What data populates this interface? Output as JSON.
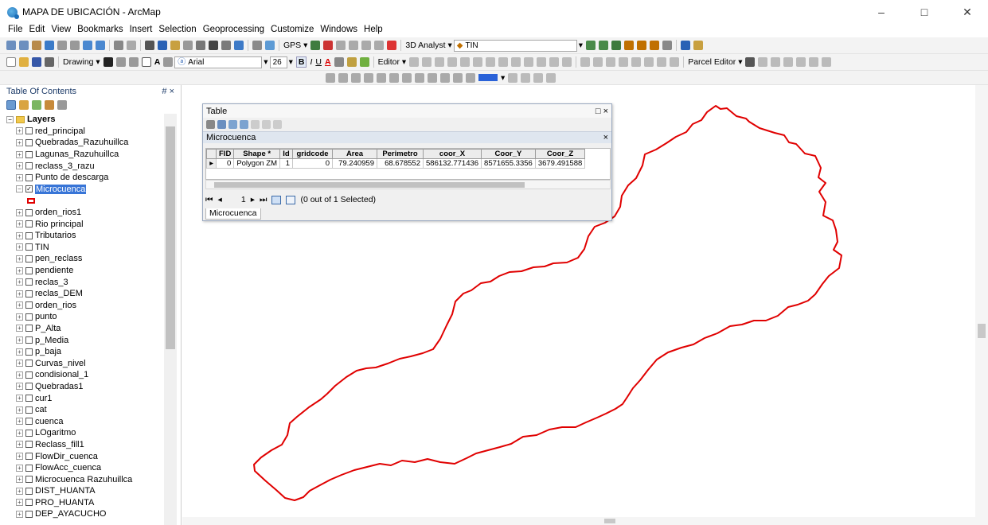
{
  "window": {
    "title": "MAPA DE UBICACIÓN - ArcMap",
    "minimize": "–",
    "maximize": "□",
    "close": "✕"
  },
  "menu": [
    "File",
    "Edit",
    "View",
    "Bookmarks",
    "Insert",
    "Selection",
    "Geoprocessing",
    "Customize",
    "Windows",
    "Help"
  ],
  "toolbar1": {
    "gps": "GPS ▾",
    "analyst": "3D Analyst ▾",
    "tin": "TIN"
  },
  "toolbar2": {
    "drawing": "Drawing ▾",
    "font": "Arial",
    "size": "26",
    "bold": "B",
    "italic": "I",
    "underline": "U",
    "editor": "Editor ▾",
    "parcel": "Parcel Editor ▾"
  },
  "toc": {
    "title": "Table Of Contents",
    "pin": "# ×",
    "root": "Layers",
    "layers": [
      {
        "name": "red_principal",
        "checked": false
      },
      {
        "name": "Quebradas_Razuhuillca",
        "checked": false
      },
      {
        "name": "Lagunas_Razuhuillca",
        "checked": false
      },
      {
        "name": "reclass_3_razu",
        "checked": false
      },
      {
        "name": "Punto de descarga",
        "checked": false
      },
      {
        "name": "Microcuenca",
        "checked": true,
        "selected": true
      },
      {
        "name": "orden_rios1",
        "checked": false
      },
      {
        "name": "Rio principal",
        "checked": false
      },
      {
        "name": "Tributarios",
        "checked": false
      },
      {
        "name": "TIN",
        "checked": false
      },
      {
        "name": "pen_reclass",
        "checked": false
      },
      {
        "name": "pendiente",
        "checked": false
      },
      {
        "name": "reclas_3",
        "checked": false
      },
      {
        "name": "reclas_DEM",
        "checked": false
      },
      {
        "name": "orden_rios",
        "checked": false
      },
      {
        "name": "punto",
        "checked": false
      },
      {
        "name": "P_Alta",
        "checked": false
      },
      {
        "name": "p_Media",
        "checked": false
      },
      {
        "name": "p_baja",
        "checked": false
      },
      {
        "name": "Curvas_nivel",
        "checked": false
      },
      {
        "name": "condisional_1",
        "checked": false
      },
      {
        "name": "Quebradas1",
        "checked": false
      },
      {
        "name": "cur1",
        "checked": false
      },
      {
        "name": "cat",
        "checked": false
      },
      {
        "name": "cuenca",
        "checked": false
      },
      {
        "name": "LOgaritmo",
        "checked": false
      },
      {
        "name": "Reclass_fill1",
        "checked": false
      },
      {
        "name": "FlowDir_cuenca",
        "checked": false
      },
      {
        "name": "FlowAcc_cuenca",
        "checked": false
      },
      {
        "name": "Microcuenca Razuhuillca",
        "checked": false
      },
      {
        "name": "DIST_HUANTA",
        "checked": false
      },
      {
        "name": "PRO_HUANTA",
        "checked": false
      },
      {
        "name": "DEP_AYACUCHO",
        "checked": false
      }
    ]
  },
  "table": {
    "title": "Table",
    "layer": "Microcuenca",
    "columns": [
      "FID",
      "Shape *",
      "Id",
      "gridcode",
      "Area",
      "Perimetro",
      "coor_X",
      "Coor_Y",
      "Coor_Z"
    ],
    "row": [
      "0",
      "Polygon ZM",
      "1",
      "0",
      "79.240959",
      "68.678552",
      "586132.771436",
      "8571655.3356",
      "3679.491588"
    ],
    "record": "1",
    "selection": "(0 out of 1 Selected)",
    "tab": "Microcuenca"
  },
  "colors": {
    "polygon": "#e00000",
    "selection": "#3875d7"
  }
}
